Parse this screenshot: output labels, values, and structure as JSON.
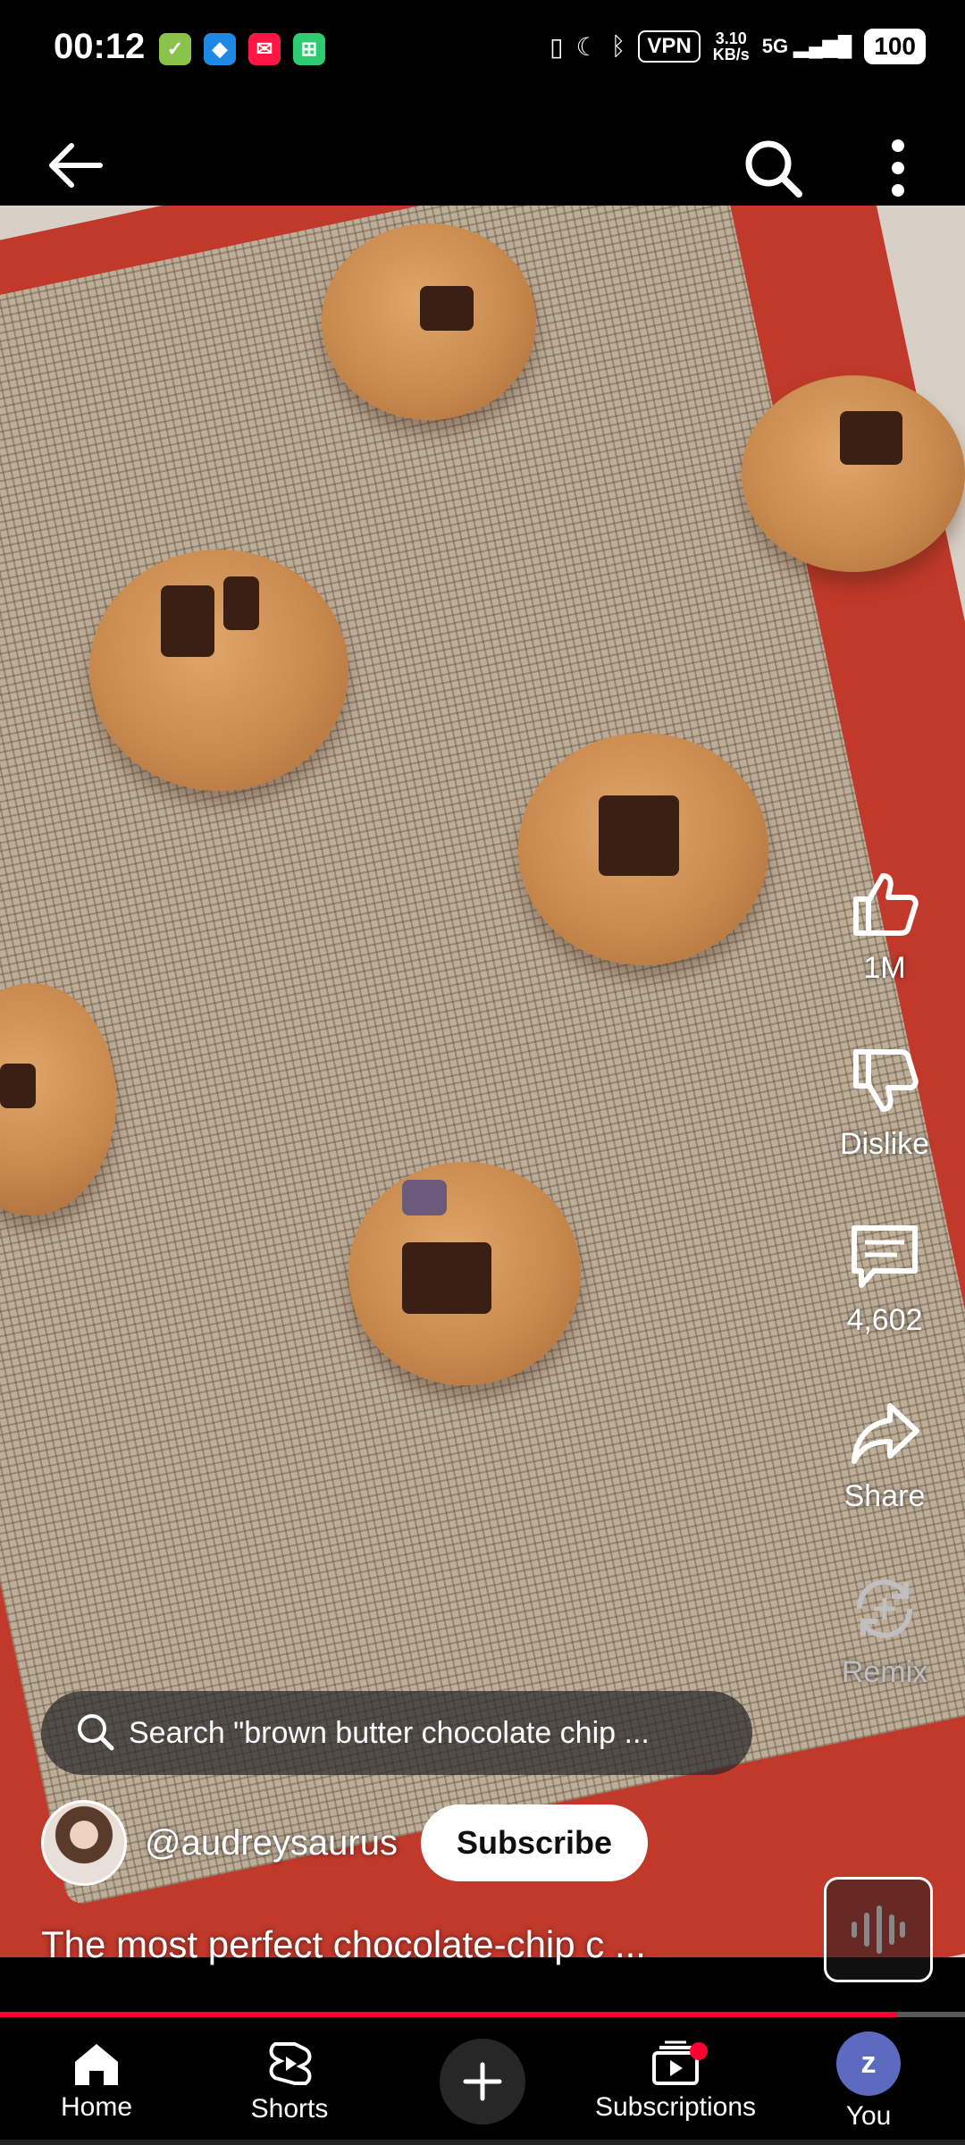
{
  "status_bar": {
    "time": "00:12",
    "apps": [
      {
        "icon": "shopping-bag-icon",
        "color": "#8bc34a",
        "glyph": "✓"
      },
      {
        "icon": "cat-app-icon",
        "color": "#1e88e5",
        "glyph": "◆"
      },
      {
        "icon": "message-app-icon",
        "color": "#ff1744",
        "glyph": "✉"
      },
      {
        "icon": "spreadsheet-app-icon",
        "color": "#2ecc71",
        "glyph": "⊞"
      }
    ],
    "vpn": "VPN",
    "net_speed_value": "3.10",
    "net_speed_unit": "KB/s",
    "network": "5G",
    "battery": "100"
  },
  "top_bar": {
    "back": "back-arrow-icon",
    "search": "search-icon",
    "menu": "more-vert-icon"
  },
  "side_actions": {
    "like_count": "1M",
    "dislike_label": "Dislike",
    "comment_count": "4,602",
    "share_label": "Share",
    "remix_label": "Remix"
  },
  "search_pill": {
    "text": "Search \"brown butter chocolate chip ..."
  },
  "channel": {
    "handle": "@audreysaurus",
    "subscribe_label": "Subscribe"
  },
  "video": {
    "title": "The most perfect chocolate-chip c ...",
    "progress": 0.93
  },
  "colors": {
    "accent": "#ff0033",
    "tray": "#c0392b"
  },
  "bottom_nav": {
    "home": "Home",
    "shorts": "Shorts",
    "subscriptions": "Subscriptions",
    "you": "You",
    "you_initial": "z"
  }
}
